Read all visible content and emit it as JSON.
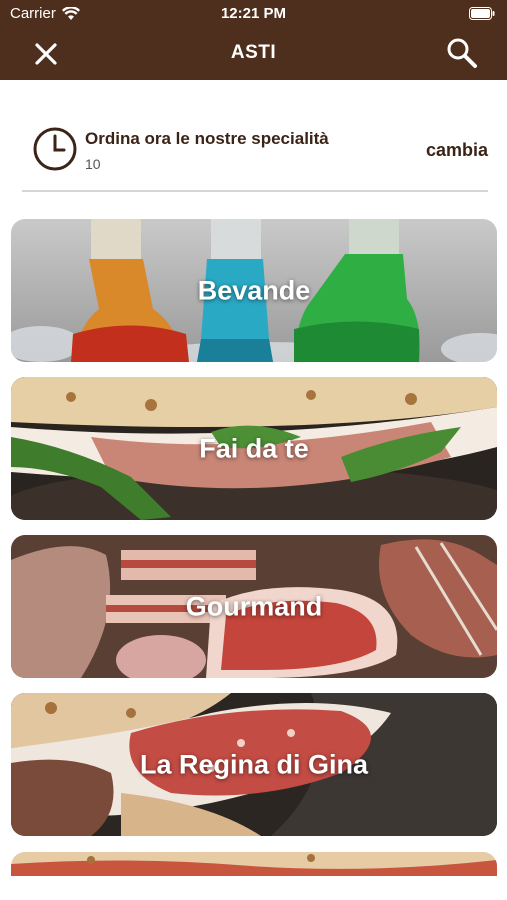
{
  "status": {
    "carrier": "Carrier",
    "time": "12:21 PM"
  },
  "nav": {
    "title": "ASTI",
    "close_icon": "close-icon",
    "search_icon": "search-icon"
  },
  "order": {
    "title": "Ordina ora le nostre specialità",
    "subtitle": "10",
    "change_label": "cambia",
    "icon": "clock-icon"
  },
  "categories": [
    {
      "label": "Bevande"
    },
    {
      "label": "Fai da te"
    },
    {
      "label": "Gourmand"
    },
    {
      "label": "La Regina di Gina"
    }
  ],
  "colors": {
    "header": "#4e2e1c",
    "accent_text": "#3b2417"
  }
}
